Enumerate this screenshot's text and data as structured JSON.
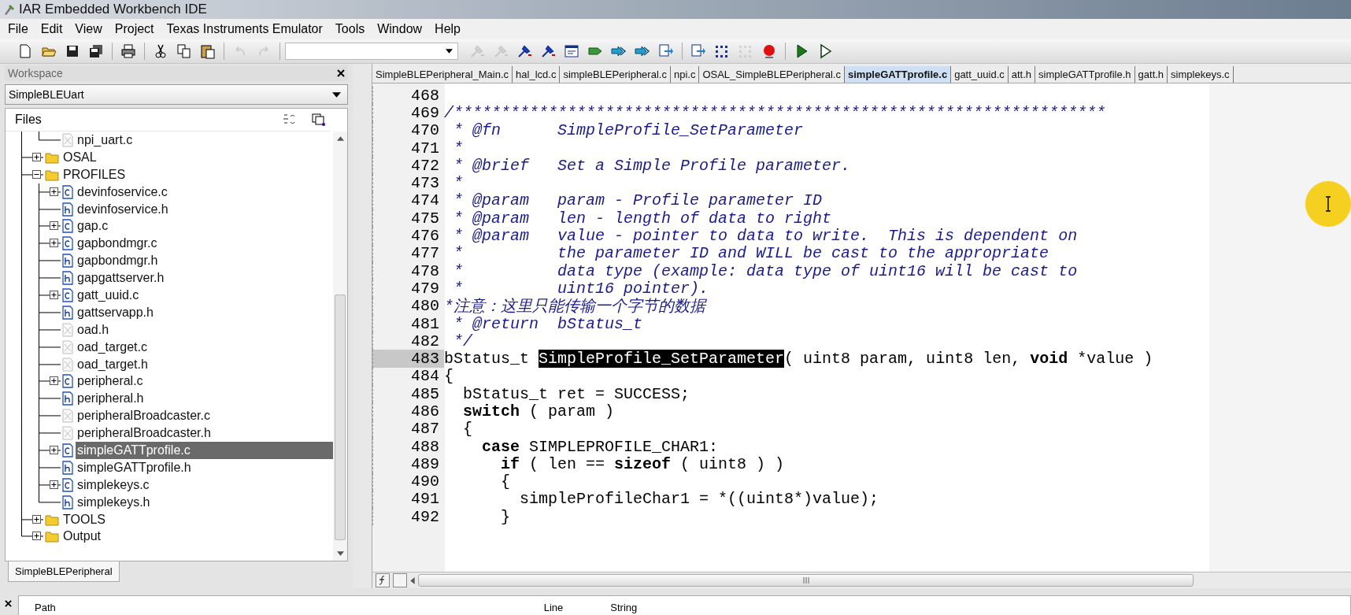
{
  "window": {
    "title": "IAR Embedded Workbench IDE"
  },
  "menu": [
    "File",
    "Edit",
    "View",
    "Project",
    "Texas Instruments Emulator",
    "Tools",
    "Window",
    "Help"
  ],
  "toolbar": [
    {
      "kind": "new",
      "disabled": false
    },
    {
      "kind": "open",
      "disabled": false
    },
    {
      "kind": "save",
      "disabled": false
    },
    {
      "kind": "saveall",
      "disabled": false
    },
    {
      "kind": "sep"
    },
    {
      "kind": "print",
      "disabled": false
    },
    {
      "kind": "sep"
    },
    {
      "kind": "cut",
      "disabled": false
    },
    {
      "kind": "copy",
      "disabled": false
    },
    {
      "kind": "paste",
      "disabled": false
    },
    {
      "kind": "sep"
    },
    {
      "kind": "undo",
      "disabled": true
    },
    {
      "kind": "redo",
      "disabled": true
    },
    {
      "kind": "sep"
    },
    {
      "kind": "combo"
    },
    {
      "kind": "wand",
      "disabled": true
    },
    {
      "kind": "wand",
      "disabled": true
    },
    {
      "kind": "wand",
      "disabled": false
    },
    {
      "kind": "wand",
      "disabled": false
    },
    {
      "kind": "panel",
      "disabled": false
    },
    {
      "kind": "tag",
      "disabled": false
    },
    {
      "kind": "arrows",
      "disabled": false
    },
    {
      "kind": "arrows",
      "disabled": false
    },
    {
      "kind": "pages",
      "disabled": false
    },
    {
      "kind": "sep"
    },
    {
      "kind": "pages",
      "disabled": false
    },
    {
      "kind": "dots",
      "disabled": false
    },
    {
      "kind": "dots",
      "disabled": true
    },
    {
      "kind": "breakpoint",
      "disabled": false
    },
    {
      "kind": "sep"
    },
    {
      "kind": "play",
      "disabled": false
    },
    {
      "kind": "playoutline",
      "disabled": false
    }
  ],
  "workspace": {
    "title": "Workspace",
    "project": "SimpleBLEUart",
    "files_header": "Files",
    "bottom_tab": "SimpleBLEPeripheral",
    "tree": [
      {
        "children": [
          {
            "name": "npi_uart.c",
            "kind": "excluded",
            "selected": false
          }
        ]
      },
      {
        "name": "OSAL",
        "kind": "folder",
        "expanded": false,
        "selected": false
      },
      {
        "name": "PROFILES",
        "kind": "folder",
        "expanded": true,
        "selected": false,
        "children": [
          {
            "name": "devinfoservice.c",
            "kind": "c",
            "expanded": false,
            "selected": false
          },
          {
            "name": "devinfoservice.h",
            "kind": "h",
            "selected": false
          },
          {
            "name": "gap.c",
            "kind": "c",
            "expanded": false,
            "selected": false
          },
          {
            "name": "gapbondmgr.c",
            "kind": "c",
            "expanded": false,
            "selected": false
          },
          {
            "name": "gapbondmgr.h",
            "kind": "h",
            "selected": false
          },
          {
            "name": "gapgattserver.h",
            "kind": "h",
            "selected": false
          },
          {
            "name": "gatt_uuid.c",
            "kind": "c",
            "expanded": false,
            "selected": false
          },
          {
            "name": "gattservapp.h",
            "kind": "h",
            "selected": false
          },
          {
            "name": "oad.h",
            "kind": "excluded",
            "selected": false
          },
          {
            "name": "oad_target.c",
            "kind": "excluded",
            "selected": false
          },
          {
            "name": "oad_target.h",
            "kind": "excluded",
            "selected": false
          },
          {
            "name": "peripheral.c",
            "kind": "c",
            "expanded": false,
            "selected": false
          },
          {
            "name": "peripheral.h",
            "kind": "h",
            "selected": false
          },
          {
            "name": "peripheralBroadcaster.c",
            "kind": "excluded",
            "selected": false
          },
          {
            "name": "peripheralBroadcaster.h",
            "kind": "excluded",
            "selected": false
          },
          {
            "name": "simpleGATTprofile.c",
            "kind": "c",
            "expanded": false,
            "selected": true
          },
          {
            "name": "simpleGATTprofile.h",
            "kind": "h",
            "selected": false
          },
          {
            "name": "simplekeys.c",
            "kind": "c",
            "expanded": false,
            "selected": false
          },
          {
            "name": "simplekeys.h",
            "kind": "h",
            "selected": false
          }
        ]
      },
      {
        "name": "TOOLS",
        "kind": "folder",
        "expanded": false,
        "selected": false
      },
      {
        "name": "Output",
        "kind": "folder",
        "expanded": false,
        "selected": false
      }
    ]
  },
  "tabs": [
    {
      "label": "SimpleBLEPeripheral_Main.c",
      "selected": false
    },
    {
      "label": "hal_lcd.c",
      "selected": false
    },
    {
      "label": "simpleBLEPeripheral.c",
      "selected": false
    },
    {
      "label": "npi.c",
      "selected": false
    },
    {
      "label": "OSAL_SimpleBLEPeripheral.c",
      "selected": false
    },
    {
      "label": "simpleGATTprofile.c",
      "selected": true
    },
    {
      "label": "gatt_uuid.c",
      "selected": false
    },
    {
      "label": "att.h",
      "selected": false
    },
    {
      "label": "simpleGATTprofile.h",
      "selected": false
    },
    {
      "label": "gatt.h",
      "selected": false
    },
    {
      "label": "simplekeys.c",
      "selected": false
    }
  ],
  "code": [
    {
      "number": "468",
      "marked": false
    },
    {
      "number": "469",
      "marked": false,
      "segments": [
        {
          "kind": "comment",
          "text": "/*********************************************************************"
        }
      ]
    },
    {
      "number": "470",
      "marked": false,
      "segments": [
        {
          "kind": "comment",
          "text": " * @fn      SimpleProfile_SetParameter"
        }
      ]
    },
    {
      "number": "471",
      "marked": false,
      "segments": [
        {
          "kind": "comment",
          "text": " *"
        }
      ]
    },
    {
      "number": "472",
      "marked": false,
      "segments": [
        {
          "kind": "comment",
          "text": " * @brief   Set a Simple Profile parameter."
        }
      ]
    },
    {
      "number": "473",
      "marked": false,
      "segments": [
        {
          "kind": "comment",
          "text": " *"
        }
      ]
    },
    {
      "number": "474",
      "marked": false,
      "segments": [
        {
          "kind": "comment",
          "text": " * @param   param - Profile parameter ID"
        }
      ]
    },
    {
      "number": "475",
      "marked": false,
      "segments": [
        {
          "kind": "comment",
          "text": " * @param   len - length of data to right"
        }
      ]
    },
    {
      "number": "476",
      "marked": false,
      "segments": [
        {
          "kind": "comment",
          "text": " * @param   value - pointer to data to write.  This is dependent on"
        }
      ]
    },
    {
      "number": "477",
      "marked": false,
      "segments": [
        {
          "kind": "comment",
          "text": " *          the parameter ID and WILL be cast to the appropriate"
        }
      ]
    },
    {
      "number": "478",
      "marked": false,
      "segments": [
        {
          "kind": "comment",
          "text": " *          data type (example: data type of uint16 will be cast to"
        }
      ]
    },
    {
      "number": "479",
      "marked": false,
      "segments": [
        {
          "kind": "comment",
          "text": " *          uint16 pointer)."
        }
      ]
    },
    {
      "number": "480",
      "marked": false,
      "segments": [
        {
          "kind": "comment",
          "text": "*注意：这里只能传输一个字节的数据"
        }
      ]
    },
    {
      "number": "481",
      "marked": false,
      "segments": [
        {
          "kind": "comment",
          "text": " * @return  bStatus_t"
        }
      ]
    },
    {
      "number": "482",
      "marked": false,
      "segments": [
        {
          "kind": "comment",
          "text": " */"
        }
      ]
    },
    {
      "number": "483",
      "marked": true,
      "segments": [
        {
          "kind": "plain",
          "text": "bStatus_t "
        },
        {
          "kind": "highlight",
          "text": "SimpleProfile_SetParameter"
        },
        {
          "kind": "plain",
          "text": "( uint8 param, uint8 len, "
        },
        {
          "kind": "keyword",
          "text": "void"
        },
        {
          "kind": "plain",
          "text": " *value )"
        }
      ]
    },
    {
      "number": "484",
      "marked": false,
      "segments": [
        {
          "kind": "plain",
          "text": "{"
        }
      ]
    },
    {
      "number": "485",
      "marked": false,
      "segments": [
        {
          "kind": "plain",
          "text": "  bStatus_t ret = SUCCESS;"
        }
      ]
    },
    {
      "number": "486",
      "marked": false,
      "segments": [
        {
          "kind": "keyword",
          "text": "  switch"
        },
        {
          "kind": "plain",
          "text": " ( param )"
        }
      ]
    },
    {
      "number": "487",
      "marked": false,
      "segments": [
        {
          "kind": "plain",
          "text": "  {"
        }
      ]
    },
    {
      "number": "488",
      "marked": false,
      "segments": [
        {
          "kind": "keyword",
          "text": "    case"
        },
        {
          "kind": "plain",
          "text": " SIMPLEPROFILE_CHAR1:"
        }
      ]
    },
    {
      "number": "489",
      "marked": false,
      "segments": [
        {
          "kind": "keyword",
          "text": "      if"
        },
        {
          "kind": "plain",
          "text": " ( len == "
        },
        {
          "kind": "keyword",
          "text": "sizeof"
        },
        {
          "kind": "plain",
          "text": " ( uint8 ) )"
        }
      ]
    },
    {
      "number": "490",
      "marked": false,
      "segments": [
        {
          "kind": "plain",
          "text": "      {"
        }
      ]
    },
    {
      "number": "491",
      "marked": false,
      "segments": [
        {
          "kind": "plain",
          "text": "        simpleProfileChar1 = *((uint8*)value);"
        }
      ]
    },
    {
      "number": "492",
      "marked": false,
      "segments": [
        {
          "kind": "plain",
          "text": "      }"
        }
      ]
    }
  ],
  "messages": {
    "columns": [
      "Path",
      "Line",
      "String"
    ]
  }
}
